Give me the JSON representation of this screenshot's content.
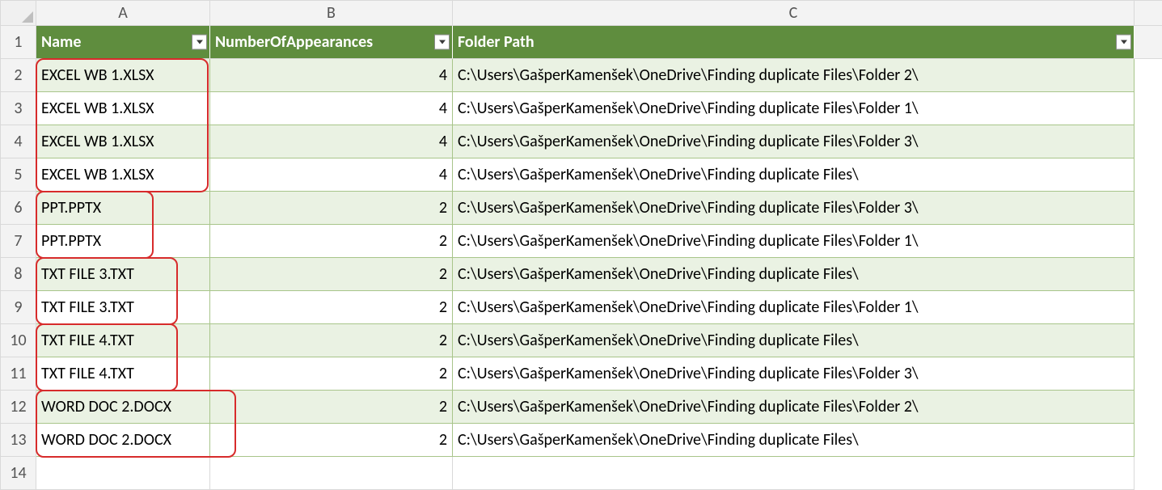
{
  "columns": [
    "A",
    "B",
    "C"
  ],
  "headers": {
    "name": "Name",
    "appearances": "NumberOfAppearances",
    "folder": "Folder Path"
  },
  "rows": [
    {
      "name": "EXCEL WB 1.XLSX",
      "count": 4,
      "path": "C:\\Users\\GašperKamenšek\\OneDrive\\Finding duplicate Files\\Folder 2\\"
    },
    {
      "name": "EXCEL WB 1.XLSX",
      "count": 4,
      "path": "C:\\Users\\GašperKamenšek\\OneDrive\\Finding duplicate Files\\Folder 1\\"
    },
    {
      "name": "EXCEL WB 1.XLSX",
      "count": 4,
      "path": "C:\\Users\\GašperKamenšek\\OneDrive\\Finding duplicate Files\\Folder 3\\"
    },
    {
      "name": "EXCEL WB 1.XLSX",
      "count": 4,
      "path": "C:\\Users\\GašperKamenšek\\OneDrive\\Finding duplicate Files\\"
    },
    {
      "name": "PPT.PPTX",
      "count": 2,
      "path": "C:\\Users\\GašperKamenšek\\OneDrive\\Finding duplicate Files\\Folder 3\\"
    },
    {
      "name": "PPT.PPTX",
      "count": 2,
      "path": "C:\\Users\\GašperKamenšek\\OneDrive\\Finding duplicate Files\\Folder 1\\"
    },
    {
      "name": "TXT FILE 3.TXT",
      "count": 2,
      "path": "C:\\Users\\GašperKamenšek\\OneDrive\\Finding duplicate Files\\"
    },
    {
      "name": "TXT FILE 3.TXT",
      "count": 2,
      "path": "C:\\Users\\GašperKamenšek\\OneDrive\\Finding duplicate Files\\Folder 1\\"
    },
    {
      "name": "TXT FILE 4.TXT",
      "count": 2,
      "path": "C:\\Users\\GašperKamenšek\\OneDrive\\Finding duplicate Files\\"
    },
    {
      "name": "TXT FILE 4.TXT",
      "count": 2,
      "path": "C:\\Users\\GašperKamenšek\\OneDrive\\Finding duplicate Files\\Folder 3\\"
    },
    {
      "name": "WORD DOC 2.DOCX",
      "count": 2,
      "path": "C:\\Users\\GašperKamenšek\\OneDrive\\Finding duplicate Files\\Folder 2\\"
    },
    {
      "name": "WORD DOC 2.DOCX",
      "count": 2,
      "path": "C:\\Users\\GašperKamenšek\\OneDrive\\Finding duplicate Files\\"
    }
  ],
  "annotation_groups": [
    {
      "startRow": 2,
      "endRow": 5,
      "widthClass": "w1"
    },
    {
      "startRow": 6,
      "endRow": 7,
      "widthClass": "w2"
    },
    {
      "startRow": 8,
      "endRow": 9,
      "widthClass": "w3"
    },
    {
      "startRow": 10,
      "endRow": 11,
      "widthClass": "w3"
    },
    {
      "startRow": 12,
      "endRow": 13,
      "widthClass": "w4"
    }
  ]
}
